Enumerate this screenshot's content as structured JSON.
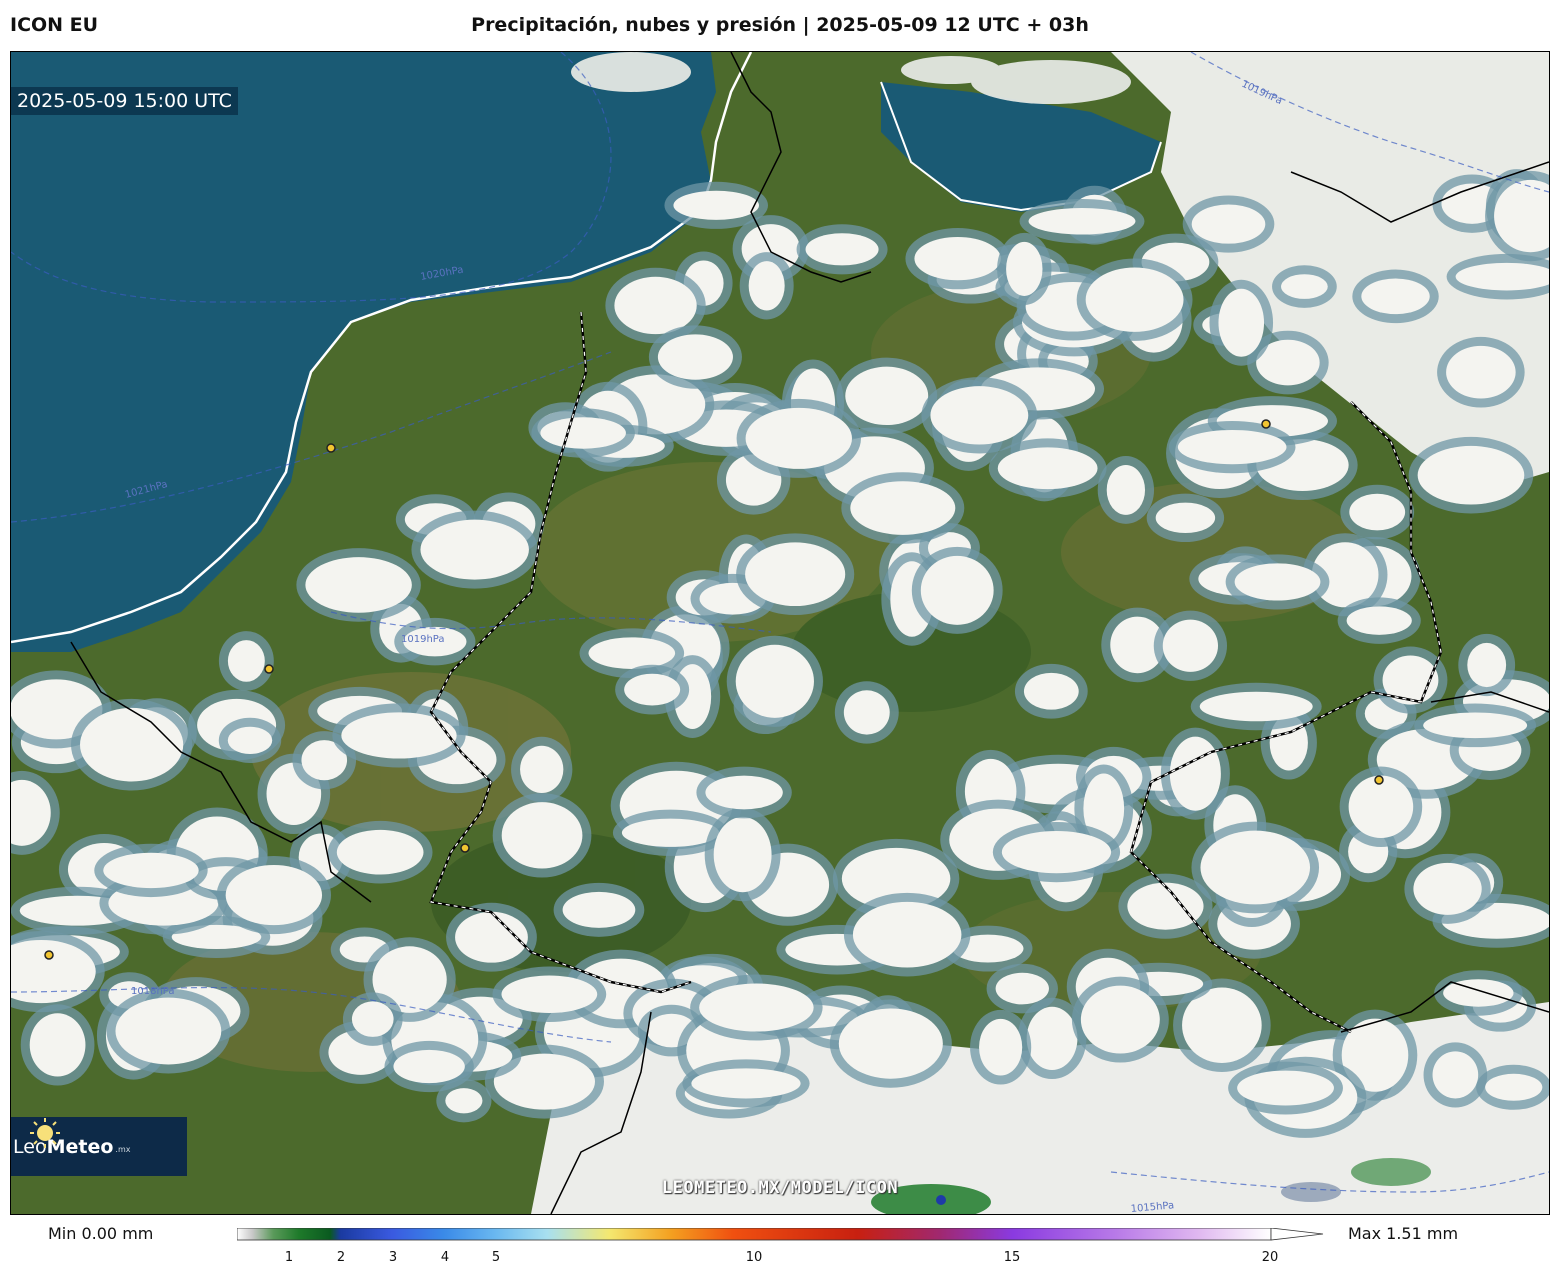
{
  "header": {
    "model": "ICON EU",
    "title": "Precipitación, nubes y presión | 2025-05-09 12 UTC + 03h"
  },
  "map": {
    "valid_time": "2025-05-09 15:00 UTC",
    "isobar_labels": [
      "1019hPa",
      "1020hPa",
      "1021hPa",
      "1019hPa",
      "1018hPa",
      "1015hPa"
    ],
    "watermark": "LEOMETEO.MX/MODEL/ICON",
    "colors": {
      "sea": "#1a5a74",
      "land": "#4c6a2c",
      "cloud": "#f4f4f0",
      "cloud_edge": "#6f97a6"
    }
  },
  "logo": {
    "name_light": "Leo",
    "name_bold": "Meteo",
    "tld": ".mx"
  },
  "legend": {
    "min_label": "Min 0.00 mm",
    "max_label": "Max 1.51 mm",
    "ticks": [
      "1",
      "2",
      "3",
      "4",
      "5",
      "10",
      "15",
      "20"
    ]
  }
}
